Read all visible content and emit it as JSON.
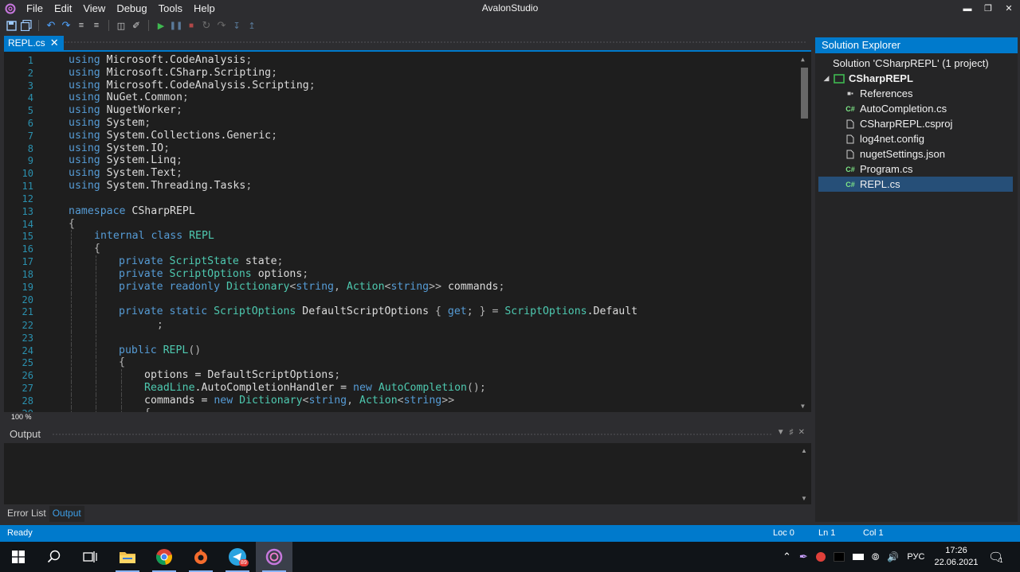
{
  "app": {
    "title": "AvalonStudio",
    "menu": [
      "File",
      "Edit",
      "View",
      "Debug",
      "Tools",
      "Help"
    ],
    "window_controls": [
      "minimize-icon",
      "restore-icon",
      "close-icon"
    ]
  },
  "toolbar": {
    "icons": [
      "save-icon",
      "save-all-icon",
      "undo-icon",
      "redo-icon",
      "comment-icon",
      "uncomment-icon",
      "build-icon",
      "clean-icon",
      "run-icon",
      "pause-icon",
      "stop-icon",
      "restart-icon",
      "step-over-icon",
      "step-into-icon",
      "step-out-icon"
    ]
  },
  "editor": {
    "tab_label": "REPL.cs",
    "zoom": "100 %",
    "lines": [
      {
        "n": "1",
        "indent": 0,
        "tokens": [
          [
            "kw",
            "using"
          ],
          [
            "pl",
            " Microsoft.CodeAnalysis"
          ],
          [
            "pu",
            ";"
          ]
        ]
      },
      {
        "n": "2",
        "indent": 0,
        "tokens": [
          [
            "kw",
            "using"
          ],
          [
            "pl",
            " Microsoft.CSharp.Scripting"
          ],
          [
            "pu",
            ";"
          ]
        ]
      },
      {
        "n": "3",
        "indent": 0,
        "tokens": [
          [
            "kw",
            "using"
          ],
          [
            "pl",
            " Microsoft.CodeAnalysis.Scripting"
          ],
          [
            "pu",
            ";"
          ]
        ]
      },
      {
        "n": "4",
        "indent": 0,
        "tokens": [
          [
            "kw",
            "using"
          ],
          [
            "pl",
            " NuGet.Common"
          ],
          [
            "pu",
            ";"
          ]
        ]
      },
      {
        "n": "5",
        "indent": 0,
        "tokens": [
          [
            "kw",
            "using"
          ],
          [
            "pl",
            " NugetWorker"
          ],
          [
            "pu",
            ";"
          ]
        ]
      },
      {
        "n": "6",
        "indent": 0,
        "tokens": [
          [
            "kw",
            "using"
          ],
          [
            "pl",
            " System"
          ],
          [
            "pu",
            ";"
          ]
        ]
      },
      {
        "n": "7",
        "indent": 0,
        "tokens": [
          [
            "kw",
            "using"
          ],
          [
            "pl",
            " System.Collections.Generic"
          ],
          [
            "pu",
            ";"
          ]
        ]
      },
      {
        "n": "8",
        "indent": 0,
        "tokens": [
          [
            "kw",
            "using"
          ],
          [
            "pl",
            " System.IO"
          ],
          [
            "pu",
            ";"
          ]
        ]
      },
      {
        "n": "9",
        "indent": 0,
        "tokens": [
          [
            "kw",
            "using"
          ],
          [
            "pl",
            " System.Linq"
          ],
          [
            "pu",
            ";"
          ]
        ]
      },
      {
        "n": "10",
        "indent": 0,
        "tokens": [
          [
            "kw",
            "using"
          ],
          [
            "pl",
            " System.Text"
          ],
          [
            "pu",
            ";"
          ]
        ]
      },
      {
        "n": "11",
        "indent": 0,
        "tokens": [
          [
            "kw",
            "using"
          ],
          [
            "pl",
            " System.Threading.Tasks"
          ],
          [
            "pu",
            ";"
          ]
        ]
      },
      {
        "n": "12",
        "indent": 0,
        "tokens": []
      },
      {
        "n": "13",
        "indent": 0,
        "tokens": [
          [
            "kw",
            "namespace"
          ],
          [
            "pl",
            " CSharpREPL"
          ]
        ]
      },
      {
        "n": "14",
        "indent": 0,
        "tokens": [
          [
            "pu",
            "{"
          ]
        ]
      },
      {
        "n": "15",
        "indent": 1,
        "tokens": [
          [
            "kw",
            "internal class"
          ],
          [
            "pl",
            " "
          ],
          [
            "ty",
            "REPL"
          ]
        ]
      },
      {
        "n": "16",
        "indent": 1,
        "tokens": [
          [
            "pu",
            "{"
          ]
        ]
      },
      {
        "n": "17",
        "indent": 2,
        "tokens": [
          [
            "kw",
            "private"
          ],
          [
            "pl",
            " "
          ],
          [
            "ty",
            "ScriptState"
          ],
          [
            "pl",
            " state"
          ],
          [
            "pu",
            ";"
          ]
        ]
      },
      {
        "n": "18",
        "indent": 2,
        "tokens": [
          [
            "kw",
            "private"
          ],
          [
            "pl",
            " "
          ],
          [
            "ty",
            "ScriptOptions"
          ],
          [
            "pl",
            " options"
          ],
          [
            "pu",
            ";"
          ]
        ]
      },
      {
        "n": "19",
        "indent": 2,
        "tokens": [
          [
            "kw",
            "private readonly"
          ],
          [
            "pl",
            " "
          ],
          [
            "ty",
            "Dictionary"
          ],
          [
            "pu",
            "<"
          ],
          [
            "kw",
            "string"
          ],
          [
            "pu",
            ", "
          ],
          [
            "ty",
            "Action"
          ],
          [
            "pu",
            "<"
          ],
          [
            "kw",
            "string"
          ],
          [
            "pu",
            ">>"
          ],
          [
            "pl",
            " commands"
          ],
          [
            "pu",
            ";"
          ]
        ]
      },
      {
        "n": "20",
        "indent": 2,
        "tokens": []
      },
      {
        "n": "21",
        "indent": 2,
        "tokens": [
          [
            "kw",
            "private static"
          ],
          [
            "pl",
            " "
          ],
          [
            "ty",
            "ScriptOptions"
          ],
          [
            "pl",
            " DefaultScriptOptions "
          ],
          [
            "pu",
            "{ "
          ],
          [
            "kw",
            "get"
          ],
          [
            "pu",
            "; } = "
          ],
          [
            "ty",
            "ScriptOptions"
          ],
          [
            "pl",
            ".Default"
          ]
        ]
      },
      {
        "n": "22",
        "indent": 3,
        "tokens": [
          [
            "pu",
            "  ;"
          ]
        ]
      },
      {
        "n": "23",
        "indent": 2,
        "tokens": []
      },
      {
        "n": "24",
        "indent": 2,
        "tokens": [
          [
            "kw",
            "public"
          ],
          [
            "pl",
            " "
          ],
          [
            "ty",
            "REPL"
          ],
          [
            "pu",
            "()"
          ]
        ]
      },
      {
        "n": "25",
        "indent": 2,
        "tokens": [
          [
            "pu",
            "{"
          ]
        ]
      },
      {
        "n": "26",
        "indent": 3,
        "tokens": [
          [
            "pl",
            "options = DefaultScriptOptions"
          ],
          [
            "pu",
            ";"
          ]
        ]
      },
      {
        "n": "27",
        "indent": 3,
        "tokens": [
          [
            "ty",
            "ReadLine"
          ],
          [
            "pl",
            ".AutoCompletionHandler = "
          ],
          [
            "kw",
            "new"
          ],
          [
            "pl",
            " "
          ],
          [
            "ty",
            "AutoCompletion"
          ],
          [
            "pu",
            "();"
          ]
        ]
      },
      {
        "n": "28",
        "indent": 3,
        "tokens": [
          [
            "pl",
            "commands = "
          ],
          [
            "kw",
            "new"
          ],
          [
            "pl",
            " "
          ],
          [
            "ty",
            "Dictionary"
          ],
          [
            "pu",
            "<"
          ],
          [
            "kw",
            "string"
          ],
          [
            "pu",
            ", "
          ],
          [
            "ty",
            "Action"
          ],
          [
            "pu",
            "<"
          ],
          [
            "kw",
            "string"
          ],
          [
            "pu",
            ">>"
          ]
        ]
      },
      {
        "n": "29",
        "indent": 3,
        "tokens": [
          [
            "pu",
            "{"
          ]
        ]
      }
    ]
  },
  "output_panel": {
    "title": "Output",
    "controls": [
      "dropdown-icon",
      "pin-icon",
      "close-icon"
    ]
  },
  "bottom_tabs": [
    {
      "label": "Error List",
      "active": false
    },
    {
      "label": "Output",
      "active": true
    }
  ],
  "solution_explorer": {
    "title": "Solution Explorer",
    "items": [
      {
        "label": "Solution 'CSharpREPL' (1 project)",
        "icon": "solution-icon",
        "level": 0,
        "bold": false,
        "selected": false
      },
      {
        "label": "CSharpREPL",
        "icon": "project-icon",
        "level": 1,
        "bold": true,
        "selected": false
      },
      {
        "label": "References",
        "icon": "references-icon",
        "level": 2,
        "bold": false,
        "selected": false
      },
      {
        "label": "AutoCompletion.cs",
        "icon": "csharp-file-icon",
        "level": 2,
        "bold": false,
        "selected": false
      },
      {
        "label": "CSharpREPL.csproj",
        "icon": "file-icon",
        "level": 2,
        "bold": false,
        "selected": false
      },
      {
        "label": "log4net.config",
        "icon": "file-icon",
        "level": 2,
        "bold": false,
        "selected": false
      },
      {
        "label": "nugetSettings.json",
        "icon": "file-icon",
        "level": 2,
        "bold": false,
        "selected": false
      },
      {
        "label": "Program.cs",
        "icon": "csharp-file-icon",
        "level": 2,
        "bold": false,
        "selected": false
      },
      {
        "label": "REPL.cs",
        "icon": "csharp-file-icon",
        "level": 2,
        "bold": false,
        "selected": true
      }
    ]
  },
  "status_bar": {
    "ready": "Ready",
    "loc": "Loc 0",
    "ln": "Ln 1",
    "col": "Col 1"
  },
  "taskbar": {
    "apps": [
      "windows-start-icon",
      "search-icon",
      "task-view-icon",
      "file-explorer-icon",
      "chrome-icon",
      "origin-icon",
      "telegram-icon",
      "avalonstudio-icon"
    ],
    "telegram_badge": "89",
    "language": "РУС",
    "time": "17:26",
    "date": "22.06.2021",
    "notification_count": "1"
  },
  "colors": {
    "accent": "#007acc",
    "editor_bg": "#1e1e1e",
    "keyword": "#569cd6",
    "type": "#4ec9b0",
    "line_number": "#2b91af"
  }
}
